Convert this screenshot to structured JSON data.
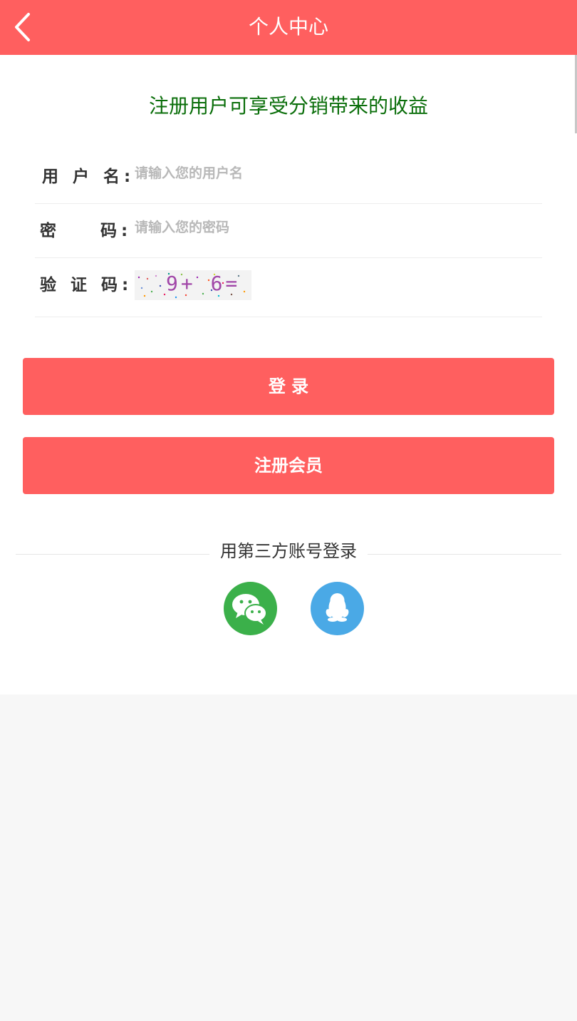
{
  "header": {
    "title": "个人中心",
    "back_icon": "chevron-left-icon"
  },
  "promo_text": "注册用户可享受分销带来的收益",
  "form": {
    "username_label": "用 户 名:",
    "username_placeholder": "请输入您的用户名",
    "password_label": "密    码:",
    "password_placeholder": "请输入您的密码",
    "captcha_label": "验 证 码:",
    "captcha_text": "9+ 6="
  },
  "buttons": {
    "login": "登 录",
    "register": "注册会员"
  },
  "third_party": {
    "label": "用第三方账号登录",
    "wechat_icon": "wechat-icon",
    "qq_icon": "qq-icon"
  },
  "colors": {
    "accent": "#ff5f5f",
    "promo_green": "#0a6e0a",
    "wechat_green": "#3bb04a",
    "qq_blue": "#4aa9e6"
  }
}
